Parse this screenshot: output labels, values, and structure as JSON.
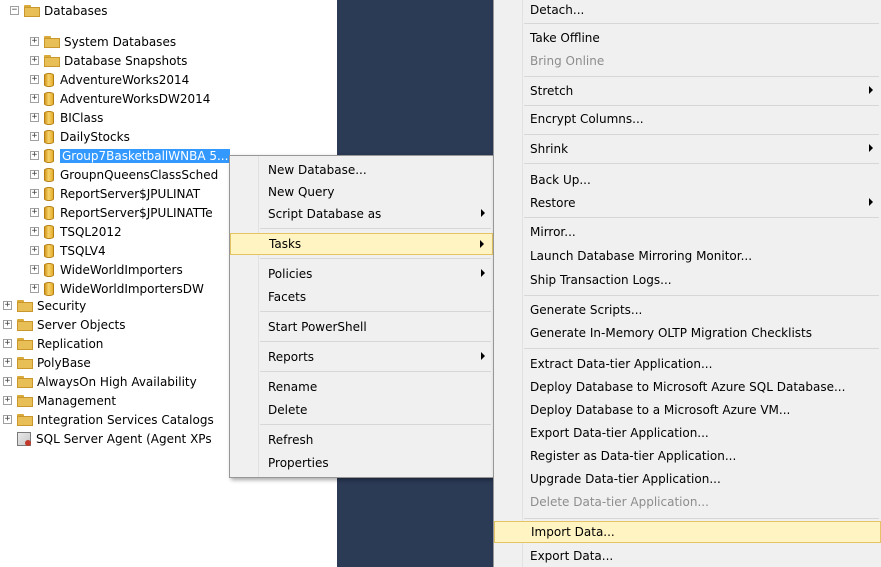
{
  "tree": {
    "cut_top_label": "",
    "databases_label": "Databases",
    "items": [
      {
        "label": "System Databases"
      },
      {
        "label": "Database Snapshots"
      },
      {
        "label": "AdventureWorks2014"
      },
      {
        "label": "AdventureWorksDW2014"
      },
      {
        "label": "BIClass"
      },
      {
        "label": "DailyStocks"
      },
      {
        "label": "Group7BasketballWNBA 5..."
      },
      {
        "label": "GroupnQueensClassSched"
      },
      {
        "label": "ReportServer$JPULINAT"
      },
      {
        "label": "ReportServer$JPULINATTe"
      },
      {
        "label": "TSQL2012"
      },
      {
        "label": "TSQLV4"
      },
      {
        "label": "WideWorldImporters"
      },
      {
        "label": "WideWorldImportersDW"
      }
    ],
    "root_items": [
      {
        "label": "Security"
      },
      {
        "label": "Server Objects"
      },
      {
        "label": "Replication"
      },
      {
        "label": "PolyBase"
      },
      {
        "label": "AlwaysOn High Availability"
      },
      {
        "label": "Management"
      },
      {
        "label": "Integration Services Catalogs"
      }
    ],
    "agent_label": "SQL Server Agent (Agent XPs"
  },
  "context_menu": {
    "items": [
      {
        "label": "New Database..."
      },
      {
        "label": "New Query"
      },
      {
        "label": "Script Database as"
      },
      {
        "label": "Tasks"
      },
      {
        "label": "Policies"
      },
      {
        "label": "Facets"
      },
      {
        "label": "Start PowerShell"
      },
      {
        "label": "Reports"
      },
      {
        "label": "Rename"
      },
      {
        "label": "Delete"
      },
      {
        "label": "Refresh"
      },
      {
        "label": "Properties"
      }
    ]
  },
  "tasks_menu": {
    "items": [
      {
        "label": "Detach..."
      },
      {
        "label": "Take Offline"
      },
      {
        "label": "Bring Online"
      },
      {
        "label": "Stretch"
      },
      {
        "label": "Encrypt Columns..."
      },
      {
        "label": "Shrink"
      },
      {
        "label": "Back Up..."
      },
      {
        "label": "Restore"
      },
      {
        "label": "Mirror..."
      },
      {
        "label": "Launch Database Mirroring Monitor..."
      },
      {
        "label": "Ship Transaction Logs..."
      },
      {
        "label": "Generate Scripts..."
      },
      {
        "label": "Generate In-Memory OLTP Migration Checklists"
      },
      {
        "label": "Extract Data-tier Application..."
      },
      {
        "label": "Deploy Database to Microsoft Azure SQL Database..."
      },
      {
        "label": "Deploy Database to a Microsoft Azure VM..."
      },
      {
        "label": "Export Data-tier Application..."
      },
      {
        "label": "Register as Data-tier Application..."
      },
      {
        "label": "Upgrade Data-tier Application..."
      },
      {
        "label": "Delete Data-tier Application..."
      },
      {
        "label": "Import Data..."
      },
      {
        "label": "Export Data..."
      }
    ]
  },
  "colors": {
    "selection": "#3399ff",
    "menu_highlight": "#fff4c2",
    "menu_highlight_border": "#e5c365",
    "mid_pane": "#2b3a55",
    "disabled_text": "#8d8d8d"
  }
}
